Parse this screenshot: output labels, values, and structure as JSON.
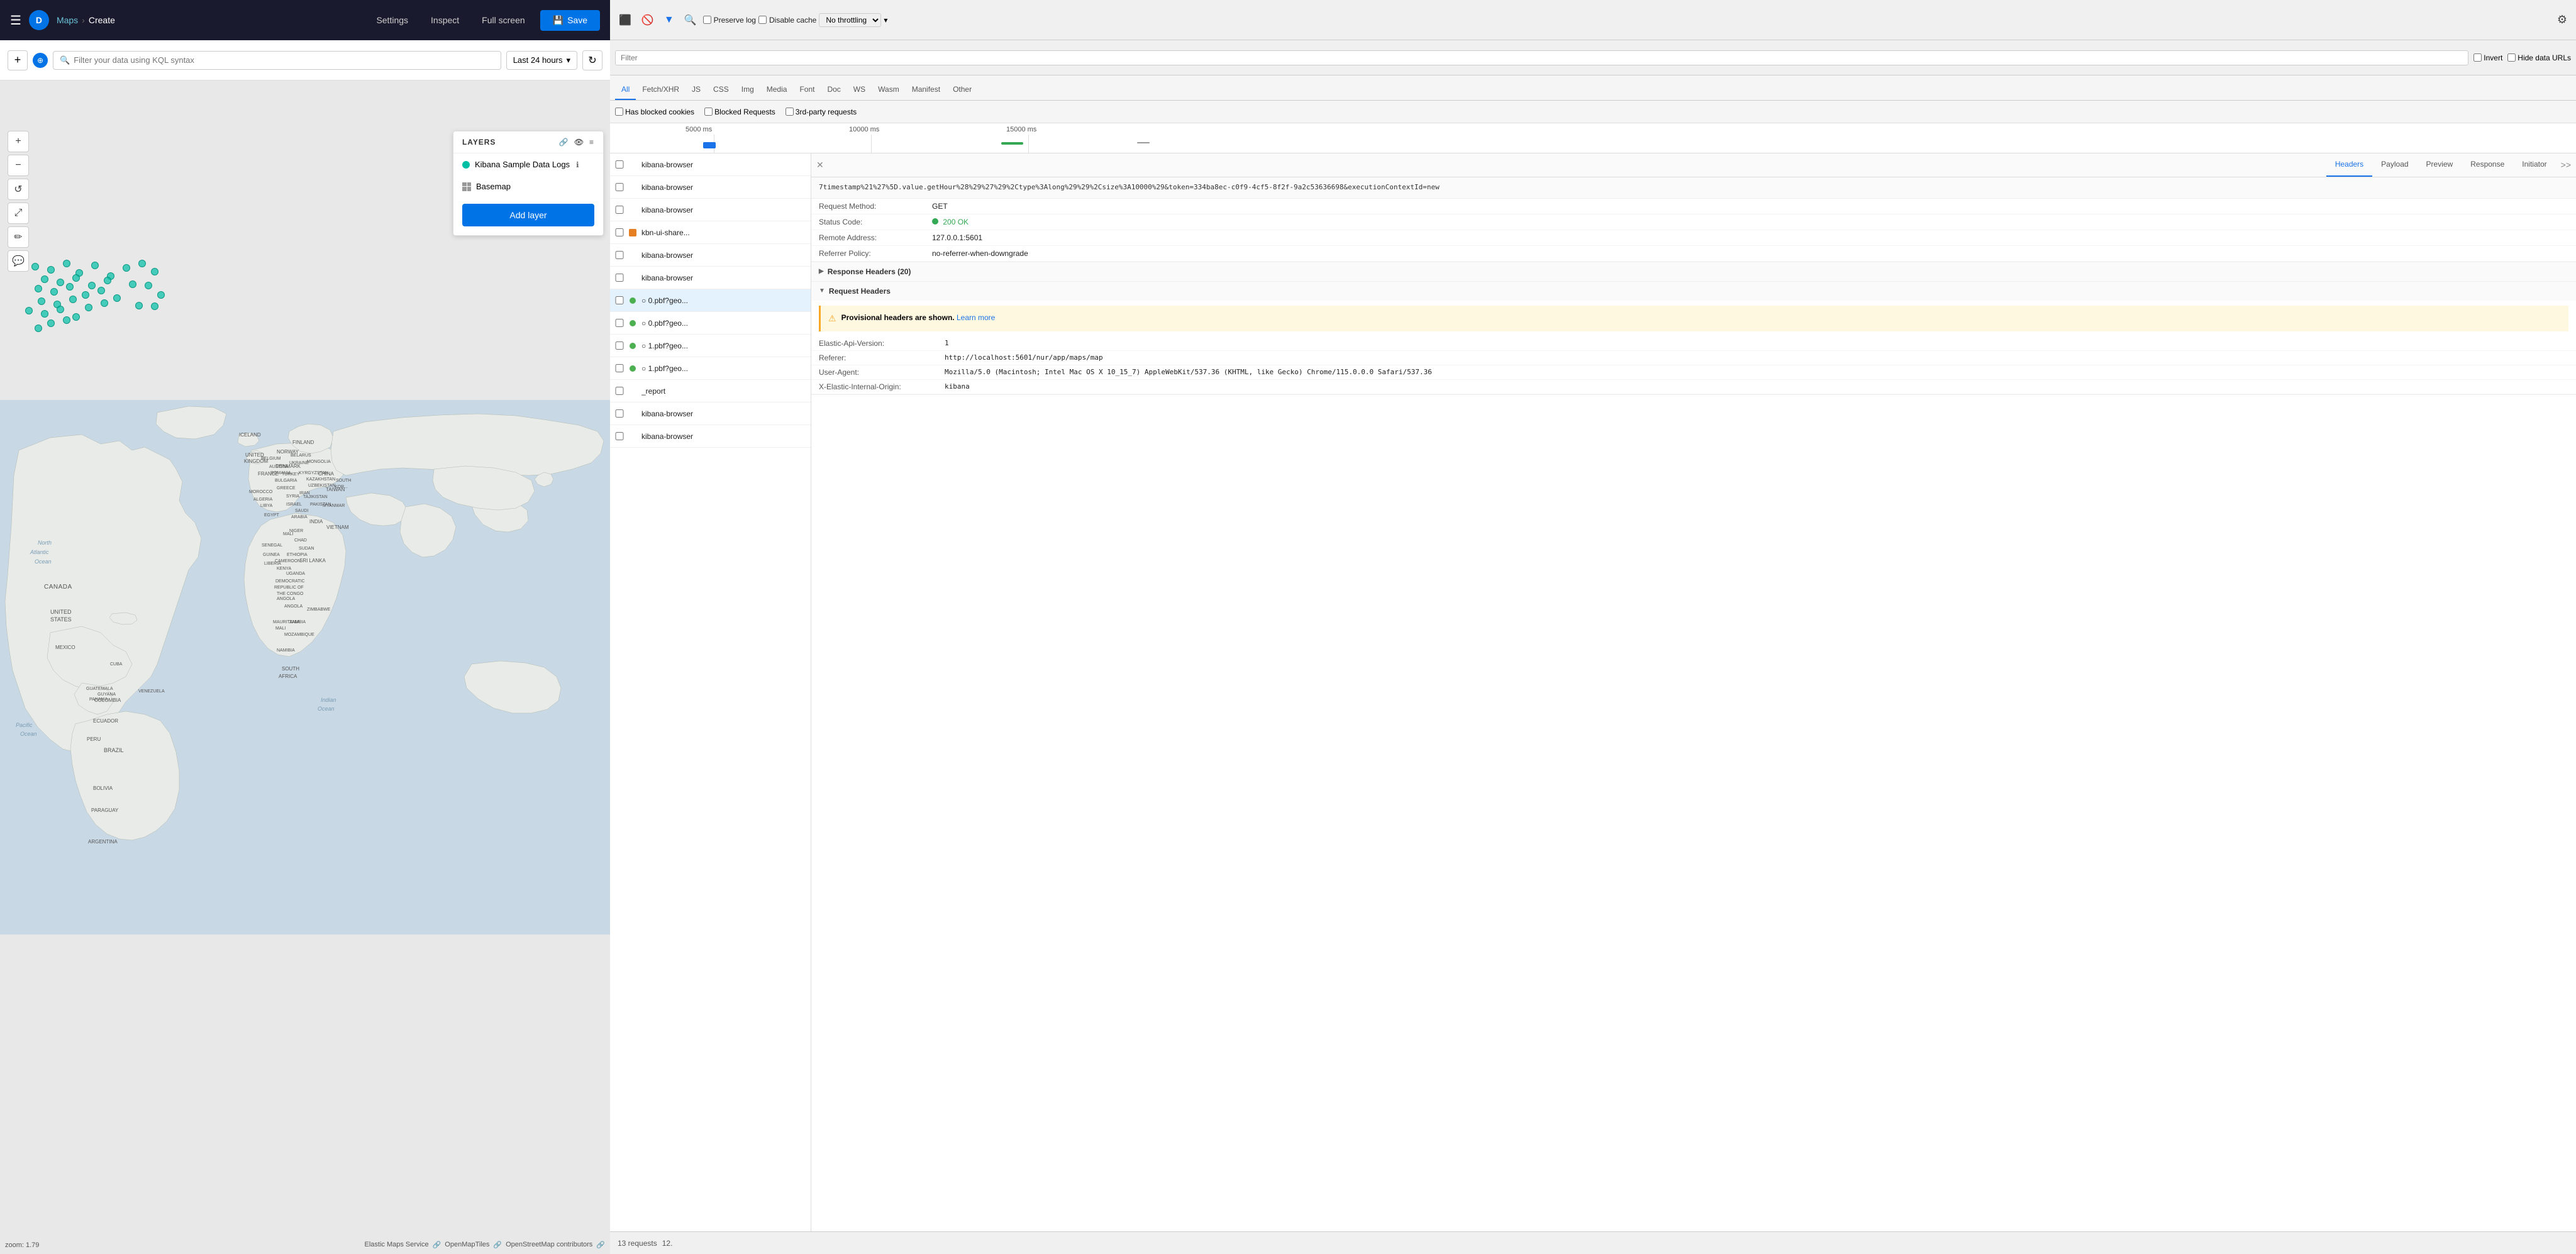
{
  "topnav": {
    "hamburger": "☰",
    "avatar": "D",
    "breadcrumbs": [
      "Maps",
      "Create"
    ],
    "settings_label": "Settings",
    "inspect_label": "Inspect",
    "fullscreen_label": "Full screen",
    "save_label": "Save",
    "save_icon": "💾"
  },
  "devtools_topbar": {
    "throttle_label": "No throttling",
    "preserve_log_label": "Preserve log",
    "disable_cache_label": "Disable cache",
    "settings_icon": "⚙"
  },
  "filter_bar": {
    "placeholder": "Filter your data using KQL syntax",
    "time_range": "Last 24 hours"
  },
  "layers": {
    "title": "LAYERS",
    "items": [
      {
        "name": "Kibana Sample Data Logs",
        "type": "dot",
        "color": "#00bfa5"
      },
      {
        "name": "Basemap",
        "type": "grid"
      }
    ],
    "add_button": "Add layer"
  },
  "map": {
    "zoom_label": "zoom: 1.79",
    "attribution1": "Elastic Maps Service",
    "attribution2": "OpenMapTiles",
    "attribution3": "OpenStreetMap contributors"
  },
  "network": {
    "filter_placeholder": "Filter",
    "invert_label": "Invert",
    "hide_data_urls_label": "Hide data URLs",
    "tabs": [
      "All",
      "Fetch/XHR",
      "JS",
      "CSS",
      "Img",
      "Media",
      "Font",
      "Doc",
      "WS",
      "Wasm",
      "Manifest",
      "Other"
    ],
    "active_tab": "All",
    "filter_rows": [
      "Has blocked cookies",
      "Blocked Requests",
      "3rd-party requests"
    ],
    "timeline_labels": [
      "5000 ms",
      "10000 ms",
      "15000 ms"
    ],
    "requests": [
      {
        "name": "kibana-browser",
        "icon": "none",
        "selected": false
      },
      {
        "name": "kibana-browser",
        "icon": "none",
        "selected": false
      },
      {
        "name": "kibana-browser",
        "icon": "none",
        "selected": false
      },
      {
        "name": "kbn-ui-share...",
        "icon": "orange",
        "selected": false
      },
      {
        "name": "kibana-browser",
        "icon": "none",
        "selected": false
      },
      {
        "name": "kibana-browser",
        "icon": "none",
        "selected": false
      },
      {
        "name": "0.pbf?geo...",
        "icon": "none",
        "selected": true,
        "circle": true
      },
      {
        "name": "0.pbf?geo...",
        "icon": "none",
        "selected": false,
        "circle": true
      },
      {
        "name": "1.pbf?geo...",
        "icon": "none",
        "selected": false,
        "circle": true
      },
      {
        "name": "1.pbf?geo...",
        "icon": "none",
        "selected": false,
        "circle": true
      },
      {
        "name": "_report",
        "icon": "none",
        "selected": false
      },
      {
        "name": "kibana-browser",
        "icon": "none",
        "selected": false
      },
      {
        "name": "kibana-browser",
        "icon": "none",
        "selected": false
      }
    ],
    "status_bar": {
      "requests": "13 requests",
      "size": "12."
    }
  },
  "details": {
    "tabs": [
      "Headers",
      "Payload",
      "Preview",
      "Response",
      "Initiator"
    ],
    "active_tab": "Headers",
    "url": "7timestamp%21%27%5D.value.getHour%28%29%27%29%2Ctype%3Along%29%29%2Csize%3A10000%29&token=334ba8ec-c0f9-4cf5-8f2f-9a2c53636698&executionContextId=new",
    "response_headers_count": "Response Headers (20)",
    "request_headers_label": "Request Headers",
    "request_method_key": "Request Method:",
    "request_method_value": "GET",
    "status_code_key": "Status Code:",
    "status_code_value": "200 OK",
    "remote_address_key": "Remote Address:",
    "remote_address_value": "127.0.0.1:5601",
    "referrer_policy_key": "Referrer Policy:",
    "referrer_policy_value": "no-referrer-when-downgrade",
    "warning_text": "Provisional headers are shown.",
    "warning_link": "Learn more",
    "request_headers": [
      {
        "key": "Elastic-Api-Version:",
        "value": "1"
      },
      {
        "key": "Referer:",
        "value": "http://localhost:5601/nur/app/maps/map"
      },
      {
        "key": "User-Agent:",
        "value": "Mozilla/5.0 (Macintosh; Intel Mac OS X 10_15_7) AppleWebKit/537.36 (KHTML, like Gecko) Chrome/115.0.0.0 Safari/537.36"
      },
      {
        "key": "X-Elastic-Internal-Origin:",
        "value": "kibana"
      }
    ]
  }
}
